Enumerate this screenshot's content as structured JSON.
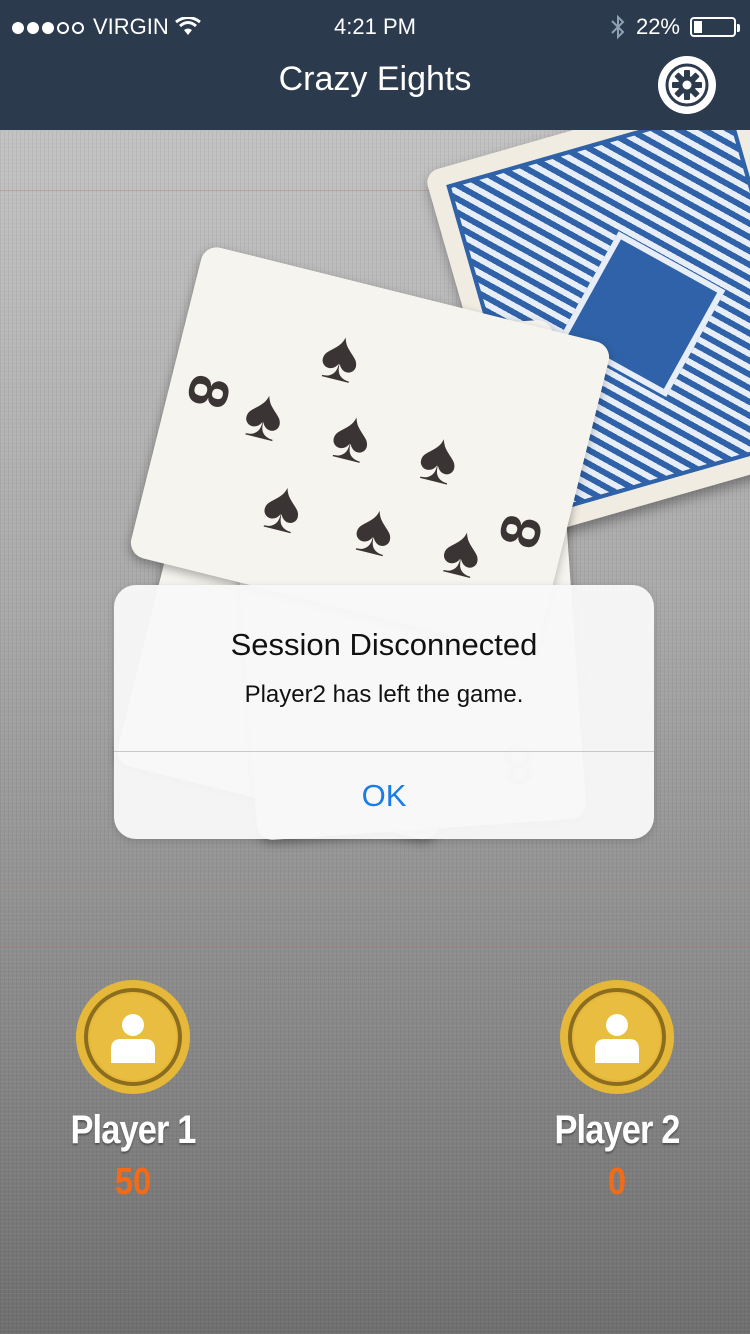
{
  "status_bar": {
    "carrier": "VIRGIN",
    "time": "4:21 PM",
    "battery": "22%",
    "battery_level": 0.22,
    "signal_bars_filled": 3,
    "signal_bars_total": 5
  },
  "header": {
    "title": "Crazy Eights",
    "settings_icon": "gear-icon"
  },
  "table": {
    "cards": [
      {
        "rank": "8",
        "suit": "spades"
      }
    ]
  },
  "alert": {
    "title": "Session Disconnected",
    "message": "Player2 has left the game.",
    "ok_label": "OK"
  },
  "players": [
    {
      "name": "Player 1",
      "score": "50",
      "icon": "user-icon"
    },
    {
      "name": "Player 2",
      "score": "0",
      "icon": "user-icon"
    }
  ],
  "colors": {
    "header_bg": "#2b3a4d",
    "accent_blue": "#1a7ce8",
    "avatar_yellow": "#e6b83a",
    "score_orange": "#f26b17"
  }
}
